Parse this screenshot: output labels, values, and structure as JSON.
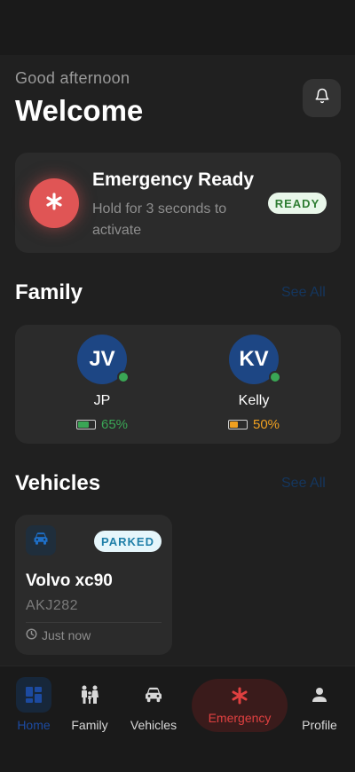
{
  "header": {
    "greeting": "Good afternoon",
    "title": "Welcome"
  },
  "emergency": {
    "title": "Emergency Ready",
    "subtitle": "Hold for 3 seconds to activate",
    "badge": "READY"
  },
  "family": {
    "section_title": "Family",
    "see_all": "See All",
    "members": [
      {
        "initials": "JV",
        "name": "JP",
        "battery": "65%",
        "battery_level": 0.65,
        "battery_color": "#3aa655"
      },
      {
        "initials": "KV",
        "name": "Kelly",
        "battery": "50%",
        "battery_level": 0.5,
        "battery_color": "#f0a020"
      }
    ]
  },
  "vehicles": {
    "section_title": "Vehicles",
    "see_all": "See All",
    "items": [
      {
        "status": "PARKED",
        "name": "Volvo xc90",
        "plate": "AKJ282",
        "updated": "Just now"
      }
    ]
  },
  "tabbar": {
    "home": "Home",
    "family": "Family",
    "vehicles": "Vehicles",
    "emergency": "Emergency",
    "profile": "Profile"
  },
  "colors": {
    "background": "#202020",
    "card": "#2b2b2b",
    "accent_blue": "#1d4684",
    "emergency_red": "#e05555",
    "online_green": "#3aa655"
  },
  "icons": {
    "notifications": "bell-icon",
    "emergency": "asterisk-icon",
    "vehicle": "car-icon",
    "time": "clock-icon",
    "home": "home-grid-icon",
    "family": "family-icon",
    "profile": "person-icon"
  }
}
